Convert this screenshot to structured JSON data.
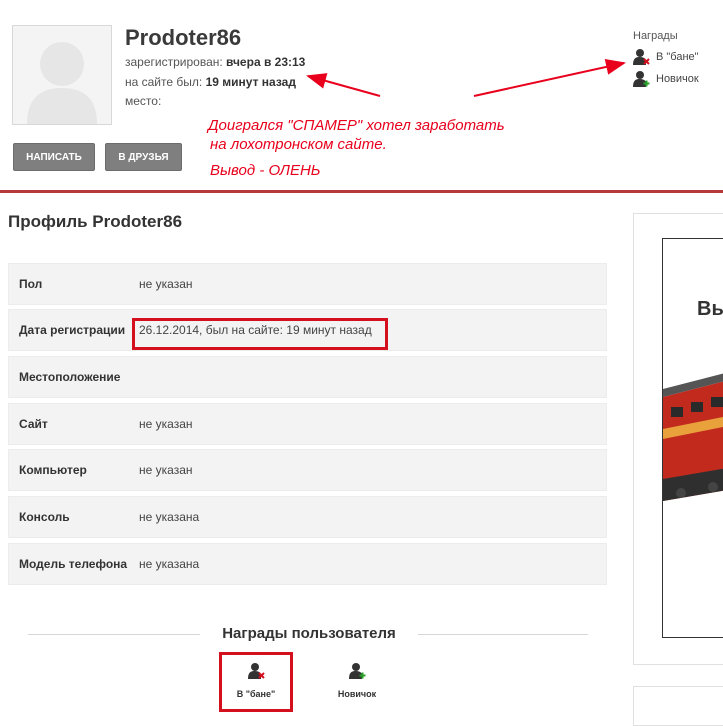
{
  "header": {
    "username": "Prodoter86",
    "registered_label": "зарегистрирован:",
    "registered_value": "вчера в 23:13",
    "lastseen_label": "на сайте был:",
    "lastseen_value": "19 минут назад",
    "place_label": "место:",
    "write_button": "НАПИСАТЬ",
    "friends_button": "В ДРУЗЬЯ",
    "awards_heading": "Награды",
    "awards": [
      {
        "label": "В \"бане\"",
        "icon": "user-ban-icon"
      },
      {
        "label": "Новичок",
        "icon": "user-add-icon"
      }
    ]
  },
  "annotation": {
    "line1": "Доигрался \"СПАМЕР\" хотел заработать",
    "line2": "на лохотронском сайте.",
    "line3": "Вывод - ОЛЕНЬ",
    "color": "#e8001c"
  },
  "profile": {
    "title": "Профиль Prodoter86",
    "rows": [
      {
        "label": "Пол",
        "value": "не указан"
      },
      {
        "label": "Дата регистрации",
        "value": "26.12.2014, был на сайте: 19 минут назад"
      },
      {
        "label": "Местоположение",
        "value": ""
      },
      {
        "label": "Сайт",
        "value": "не указан"
      },
      {
        "label": "Компьютер",
        "value": "не указан"
      },
      {
        "label": "Консоль",
        "value": "не указана"
      },
      {
        "label": "Модель телефона",
        "value": "не указана"
      }
    ]
  },
  "user_awards": {
    "title": "Награды пользователя",
    "items": [
      {
        "label": "В \"бане\"",
        "icon": "user-ban-icon"
      },
      {
        "label": "Новичок",
        "icon": "user-add-icon"
      }
    ]
  },
  "sidebar": {
    "banner_text": "Вы"
  },
  "colors": {
    "accent_divider": "#b63a3a",
    "highlight": "#d4101f",
    "button_bg": "#7f7f7f"
  }
}
